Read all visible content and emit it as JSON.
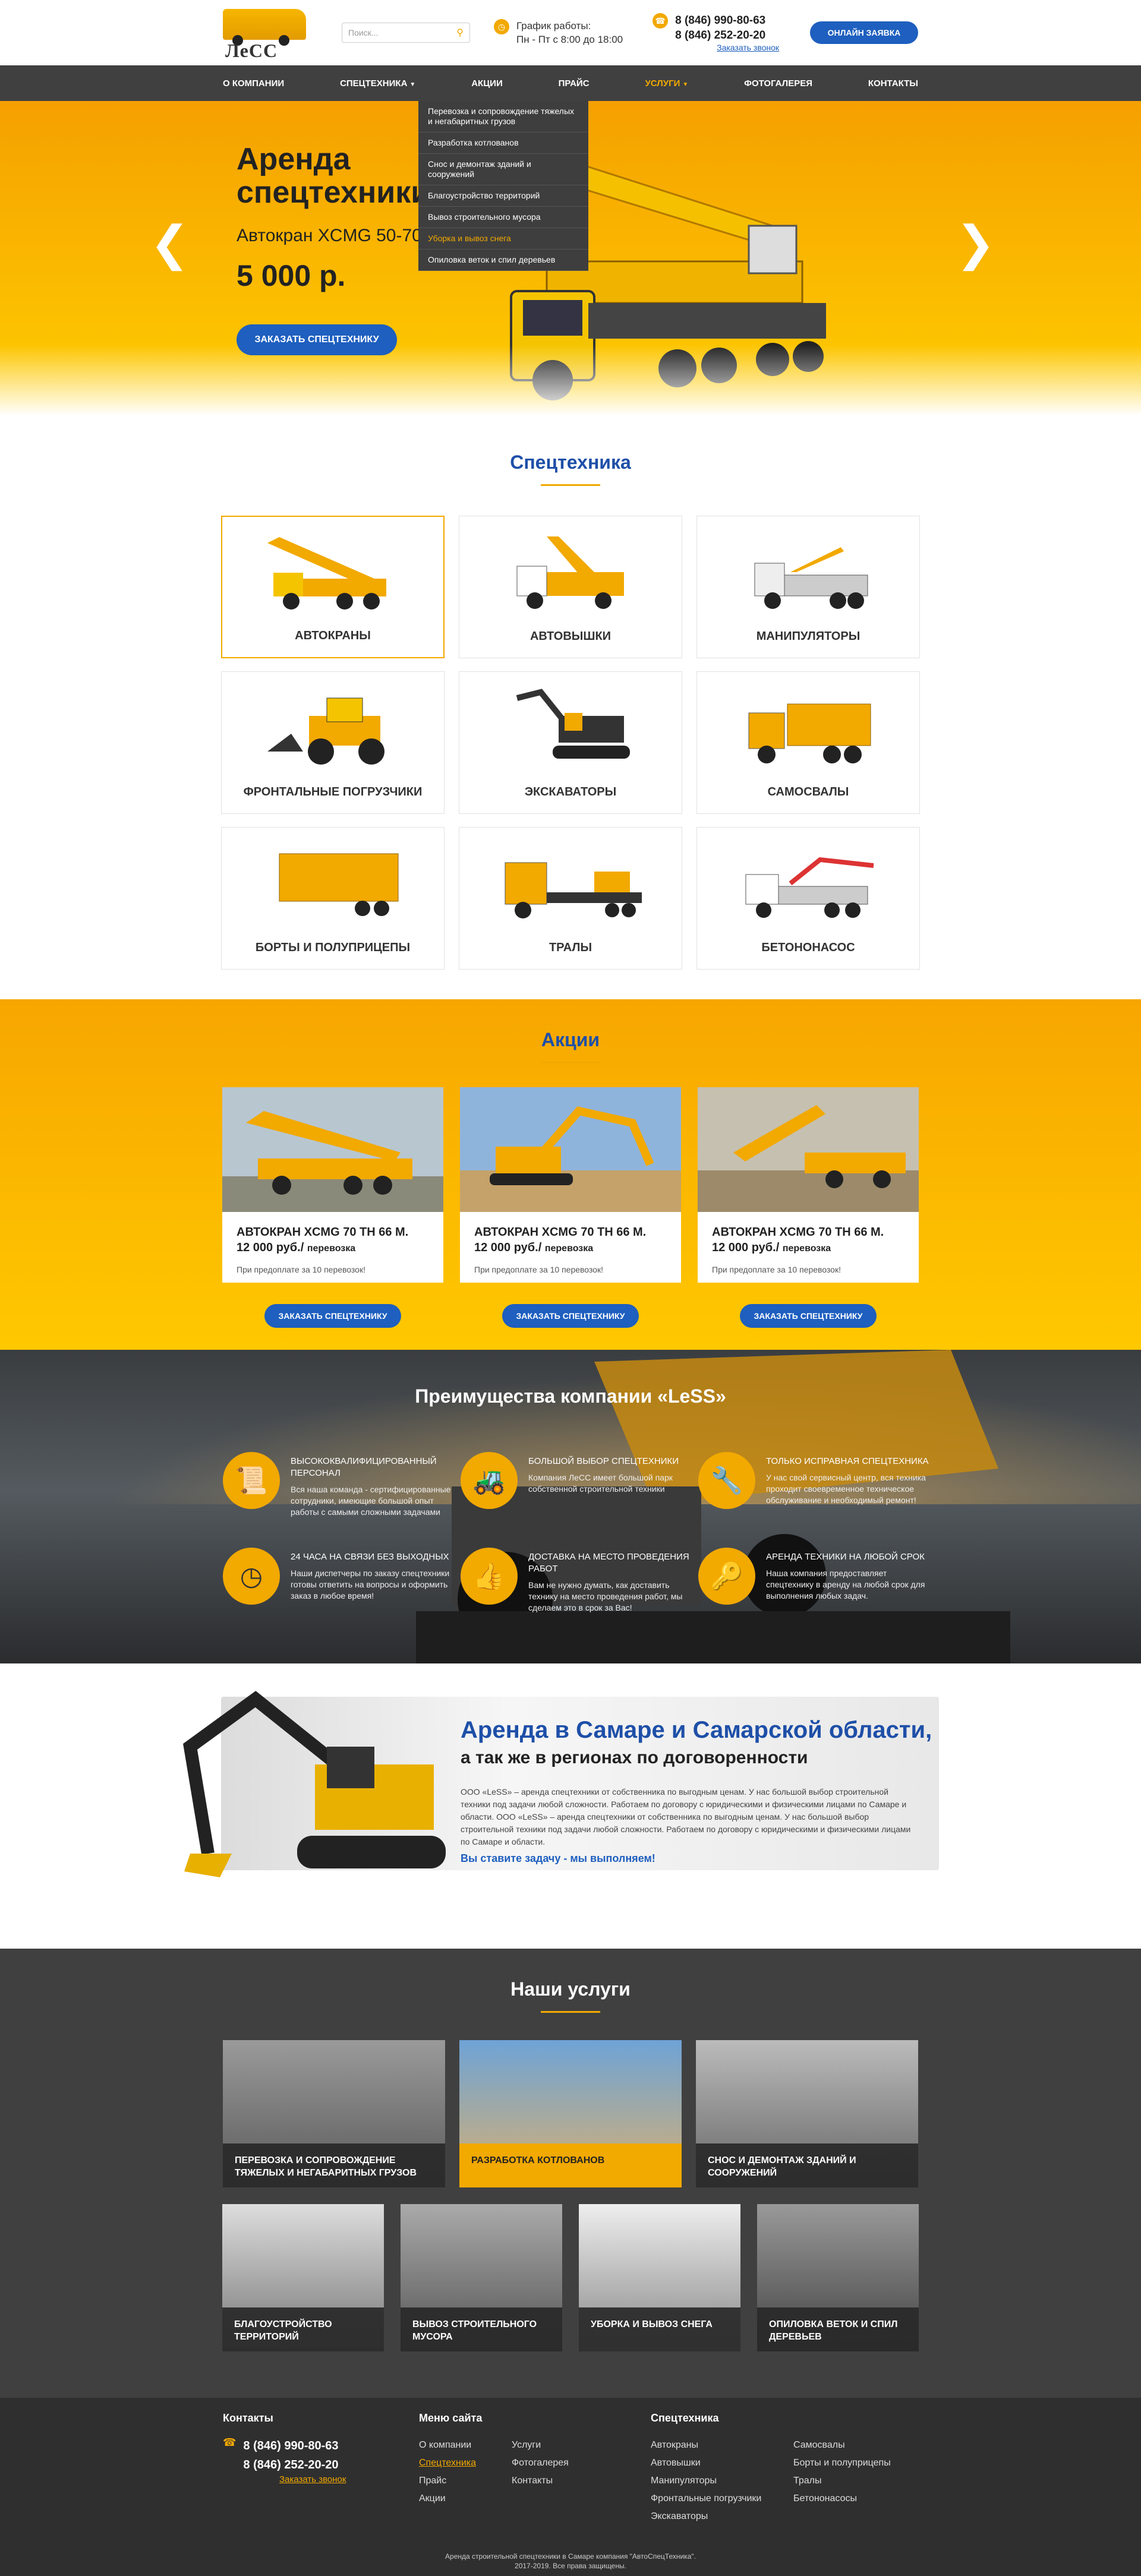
{
  "header": {
    "logo": "ЛеСС",
    "search_placeholder": "Поиск...",
    "schedule_title": "График работы:",
    "schedule_hours": "Пн - Пт с 8:00 до 18:00",
    "phone1": "8 (846) 990-80-63",
    "phone2": "8 (846) 252-20-20",
    "callback": "Заказать звонок",
    "online_btn": "ОНЛАЙН ЗАЯВКА"
  },
  "nav": [
    "О КОМПАНИИ",
    "СПЕЦТЕХНИКА",
    "АКЦИИ",
    "ПРАЙС",
    "УСЛУГИ",
    "ФОТОГАЛЕРЕЯ",
    "КОНТАКТЫ"
  ],
  "dropdown": [
    "Перевозка и сопровождение тяжелых и негабаритных грузов",
    "Разработка котлованов",
    "Снос и демонтаж зданий и сооружений",
    "Благоустройство территорий",
    "Вывоз строительного мусора",
    "Уборка и вывоз снега",
    "Опиловка веток и спил деревьев"
  ],
  "hero": {
    "title": "Аренда спецтехники",
    "subtitle": "Автокран XCMG 50-70 т.",
    "price": "5 000 р.",
    "button": "ЗАКАЗАТЬ СПЕЦТЕХНИКУ"
  },
  "spec": {
    "title": "Спецтехника",
    "items": [
      "АВТОКРАНЫ",
      "АВТОВЫШКИ",
      "МАНИПУЛЯТОРЫ",
      "ФРОНТАЛЬНЫЕ ПОГРУЗЧИКИ",
      "ЭКСКАВАТОРЫ",
      "САМОСВАЛЫ",
      "БОРТЫ И ПОЛУПРИЦЕПЫ",
      "ТРАЛЫ",
      "БЕТОНОНАСОС"
    ]
  },
  "akcii": {
    "title": "Акции",
    "cards": [
      {
        "title": "АВТОКРАН XCMG 70 ТН 66 М.",
        "price": "12 000 руб./",
        "unit": "перевозка",
        "note": "При предоплате за 10 перевозок!"
      },
      {
        "title": "АВТОКРАН XCMG 70 ТН 66 М.",
        "price": "12 000 руб./",
        "unit": "перевозка",
        "note": "При предоплате за 10 перевозок!"
      },
      {
        "title": "АВТОКРАН XCMG 70 ТН 66 М.",
        "price": "12 000 руб./",
        "unit": "перевозка",
        "note": "При предоплате за 10 перевозок!"
      }
    ],
    "button": "ЗАКАЗАТЬ СПЕЦТЕХНИКУ"
  },
  "adv": {
    "title": "Преимущества компании «LeSS»",
    "items": [
      {
        "head": "ВЫСОКОКВАЛИФИЦИРОВАННЫЙ ПЕРСОНАЛ",
        "desc": "Вся наша команда - сертифицированные сотрудники, имеющие большой опыт работы с самыми сложными задачами",
        "icon": "certificate-icon"
      },
      {
        "head": "БОЛЬШОЙ ВЫБОР СПЕЦТЕХНИКИ",
        "desc": "Компания ЛеСС имеет большой парк собственной строительной техники",
        "icon": "bulldozer-icon"
      },
      {
        "head": "ТОЛЬКО ИСПРАВНАЯ СПЕЦТЕХНИКА",
        "desc": "У нас свой сервисный центр, вся техника проходит своевременное техническое обслуживание и необходимый ремонт!",
        "icon": "tools-icon"
      },
      {
        "head": "24 ЧАСА НА СВЯЗИ БЕЗ ВЫХОДНЫХ",
        "desc": "Наши диспетчеры по заказу спецтехники готовы ответить на вопросы и оформить заказ в любое время!",
        "icon": "clock-icon"
      },
      {
        "head": "ДОСТАВКА НА МЕСТО ПРОВЕДЕНИЯ РАБОТ",
        "desc": "Вам не нужно думать, как доставить технику на место проведения работ, мы сделаем это в срок за Вас!",
        "icon": "thumbs-up-icon"
      },
      {
        "head": "АРЕНДА ТЕХНИКИ НА ЛЮБОЙ СРОК",
        "desc": "Наша компания предоставляет спецтехнику в аренду на любой срок для выполнения любых задач.",
        "icon": "key-icon"
      }
    ]
  },
  "rent": {
    "title": "Аренда в Самаре и Самарской области,",
    "subtitle": "а так же в регионах по договоренности",
    "text": "ООО «LeSS» – аренда спецтехники от собственника по выгодным ценам. У нас большой выбор строительной техники под задачи любой сложности. Работаем по договору с юридическими и физическими лицами по Самаре и области. ООО «LeSS» – аренда спецтехники от собственника по выгодным ценам. У нас большой выбор строительной техники под задачи любой сложности. Работаем по договору с юридическими и физическими лицами по Самаре и области.",
    "slogan": "Вы ставите задачу - мы выполняем!"
  },
  "services": {
    "title": "Наши услуги",
    "row1": [
      "ПЕРЕВОЗКА И СОПРОВОЖДЕНИЕ ТЯЖЕЛЫХ И НЕГАБАРИТНЫХ ГРУЗОВ",
      "РАЗРАБОТКА КОТЛОВАНОВ",
      "СНОС И ДЕМОНТАЖ ЗДАНИЙ И СООРУЖЕНИЙ"
    ],
    "row2": [
      "БЛАГОУСТРОЙСТВО ТЕРРИТОРИЙ",
      "ВЫВОЗ СТРОИТЕЛЬНОГО МУСОРА",
      "УБОРКА И ВЫВОЗ СНЕГА",
      "ОПИЛОВКА ВЕТОК И СПИЛ ДЕРЕВЬЕВ"
    ]
  },
  "footer": {
    "contacts_title": "Контакты",
    "phone1": "8 (846) 990-80-63",
    "phone2": "8 (846) 252-20-20",
    "callback": "Заказать звонок",
    "menu_title": "Меню сайта",
    "menu1": [
      "О компании",
      "Спецтехника",
      "Прайс",
      "Акции"
    ],
    "menu2": [
      "Услуги",
      "Фотогалерея",
      "Контакты"
    ],
    "spec_title": "Спецтехника",
    "spec1": [
      "Автокраны",
      "Автовышки",
      "Манипуляторы",
      "Фронтальные погрузчики",
      "Экскаваторы"
    ],
    "spec2": [
      "Самосвалы",
      "Борты и полуприцепы",
      "Тралы",
      "Бетононасосы"
    ],
    "copy1": "Аренда строительной спецтехники в Самаре компания \"АвтоСпецТехника\".",
    "copy2": "2017-2019. Все права защищены."
  },
  "colors": {
    "accent": "#f2a900",
    "blue": "#1e5fbf",
    "dark": "#404040"
  }
}
